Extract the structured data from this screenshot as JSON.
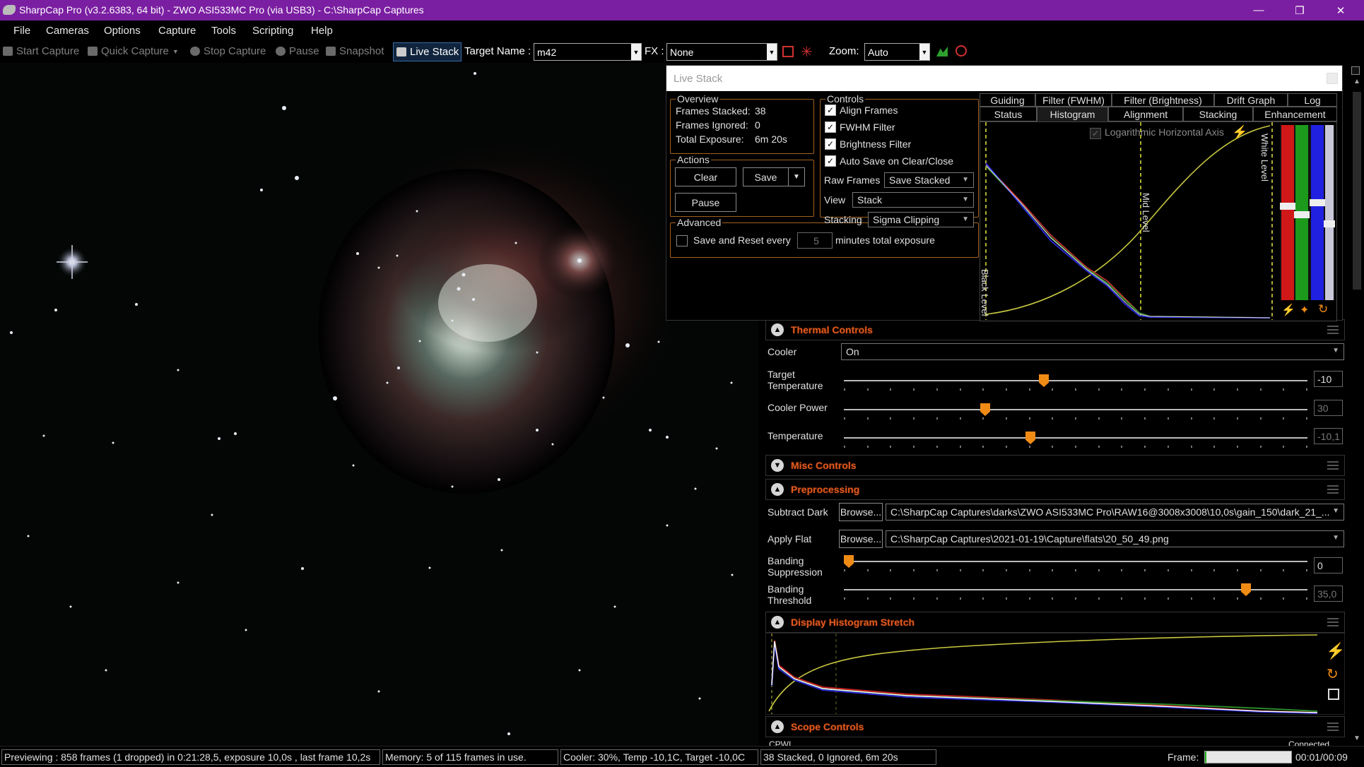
{
  "window": {
    "title": "SharpCap Pro (v3.2.6383, 64 bit) - ZWO ASI533MC Pro (via USB3) - C:\\SharpCap Captures",
    "minimize": "—",
    "restore": "❐",
    "close": "✕"
  },
  "menu": [
    "File",
    "Cameras",
    "Options",
    "Capture",
    "Tools",
    "Scripting",
    "Help"
  ],
  "toolbar": {
    "start_capture": "Start Capture",
    "quick_capture": "Quick Capture",
    "stop_capture": "Stop Capture",
    "pause": "Pause",
    "snapshot": "Snapshot",
    "live_stack": "Live Stack",
    "target_name_label": "Target Name :",
    "target_name_value": "m42",
    "fx_label": "FX :",
    "fx_value": "None",
    "zoom_label": "Zoom:",
    "zoom_value": "Auto"
  },
  "live_stack": {
    "title": "Live Stack",
    "overview": {
      "title": "Overview",
      "frames_stacked_label": "Frames Stacked:",
      "frames_stacked": "38",
      "frames_ignored_label": "Frames Ignored:",
      "frames_ignored": "0",
      "total_exposure_label": "Total Exposure:",
      "total_exposure": "6m 20s"
    },
    "actions": {
      "title": "Actions",
      "clear": "Clear",
      "save": "Save",
      "pause": "Pause"
    },
    "advanced": {
      "title": "Advanced",
      "save_reset_label": "Save and Reset every",
      "save_reset_value": "5",
      "save_reset_suffix": "minutes total exposure",
      "save_reset_checked": false
    },
    "controls": {
      "title": "Controls",
      "align_frames": "Align Frames",
      "fwhm_filter": "FWHM Filter",
      "brightness_filter": "Brightness Filter",
      "auto_save": "Auto Save on Clear/Close",
      "raw_frames_label": "Raw Frames",
      "raw_frames_value": "Save Stacked",
      "view_label": "View",
      "view_value": "Stack",
      "stacking_label": "Stacking",
      "stacking_value": "Sigma Clipping"
    },
    "tabs_row1": [
      "Guiding",
      "Filter (FWHM)",
      "Filter (Brightness)",
      "Drift Graph",
      "Log"
    ],
    "tabs_row2": [
      "Status",
      "Histogram",
      "Alignment",
      "Stacking",
      "Enhancement"
    ],
    "active_tab": "Histogram",
    "histogram": {
      "log_axis_label": "Logarithmic Horizontal Axis",
      "black_level": "Black Level",
      "mid_level": "Mid Level",
      "white_level": "White Level"
    }
  },
  "thermal": {
    "title": "Thermal Controls",
    "cooler_label": "Cooler",
    "cooler_value": "On",
    "target_temp_label": "Target Temperature",
    "target_temp_value": "-10",
    "target_temp_fraction": 0.43,
    "cooler_power_label": "Cooler Power",
    "cooler_power_value": "30",
    "cooler_power_fraction": 0.3,
    "temperature_label": "Temperature",
    "temperature_value": "-10,1",
    "temperature_fraction": 0.4
  },
  "misc": {
    "title": "Misc Controls"
  },
  "preprocessing": {
    "title": "Preprocessing",
    "subtract_dark_label": "Subtract Dark",
    "browse": "Browse...",
    "dark_path": "C:\\SharpCap Captures\\darks\\ZWO ASI533MC Pro\\RAW16@3008x3008\\10,0s\\gain_150\\dark_21_...",
    "apply_flat_label": "Apply Flat",
    "flat_path": "C:\\SharpCap Captures\\2021-01-19\\Capture\\flats\\20_50_49.png",
    "banding_suppression_label": "Banding Suppression",
    "banding_suppression_value": "0",
    "banding_suppression_fraction": 0.0,
    "banding_threshold_label": "Banding Threshold",
    "banding_threshold_value": "35,0",
    "banding_threshold_fraction": 0.875
  },
  "display_stretch": {
    "title": "Display Histogram Stretch"
  },
  "scope": {
    "title": "Scope Controls",
    "cut_left": "CPWI",
    "cut_right": "Connected"
  },
  "statusbar": {
    "preview": "Previewing : 858 frames (1 dropped) in 0:21:28,5, exposure 10,0s , last frame 10,2s",
    "memory": "Memory: 5 of 115 frames in use.",
    "cooler": "Cooler: 30%, Temp -10,1C, Target -10,0C",
    "stacked": "38 Stacked, 0 Ignored, 6m 20s",
    "frame_label": "Frame:",
    "frame_progress": 0.02,
    "frame_time": "00:01/00:09"
  },
  "colors": {
    "titlebar": "#7b1fa2",
    "accent_orange": "#f08b16",
    "section_title": "#e05a1e",
    "group_border": "#a0611f"
  }
}
